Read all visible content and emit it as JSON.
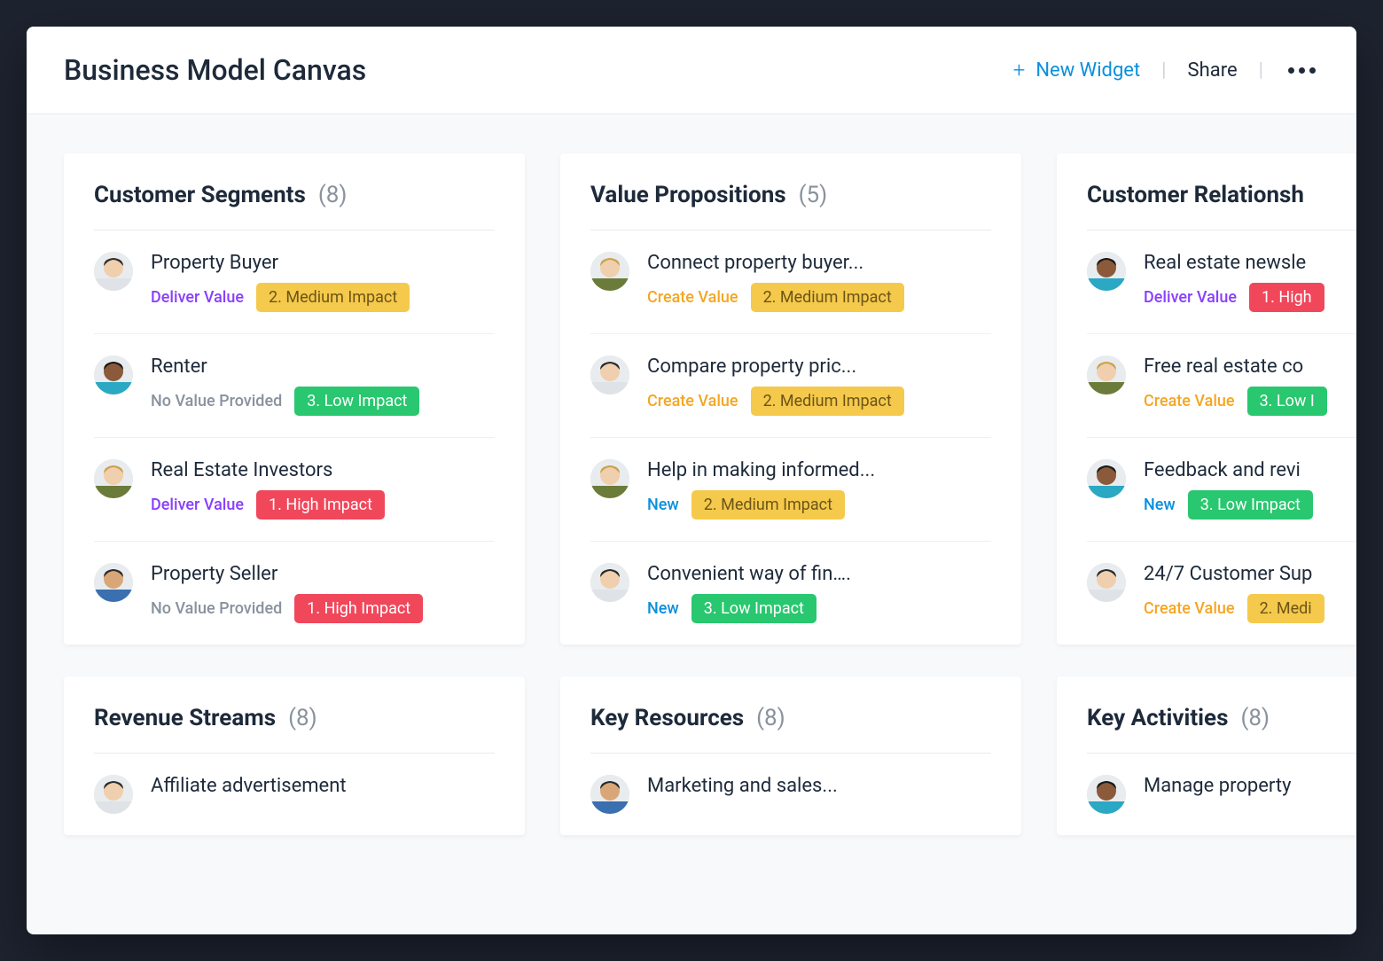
{
  "header": {
    "title": "Business Model Canvas",
    "newWidget": "New Widget",
    "share": "Share"
  },
  "tags": {
    "deliver": "Deliver Value",
    "create": "Create Value",
    "new": "New",
    "none": "No Value Provided"
  },
  "impact": {
    "high": "1. High Impact",
    "medium": "2. Medium Impact",
    "medi": "2. Medi",
    "low": "3. Low Impact",
    "lowI": "3. Low I"
  },
  "columns": [
    {
      "cards": [
        {
          "title": "Customer Segments",
          "count": "(8)",
          "rows": [
            {
              "title": "Property Buyer",
              "tag": "deliver",
              "impact": "medium",
              "avatar": "a1"
            },
            {
              "title": "Renter",
              "tag": "none",
              "impact": "low",
              "avatar": "a2",
              "ring": true
            },
            {
              "title": "Real Estate Investors",
              "tag": "deliver",
              "impact": "high",
              "avatar": "a3"
            },
            {
              "title": "Property Seller",
              "tag": "none",
              "impact": "high",
              "avatar": "a4"
            }
          ]
        },
        {
          "title": "Revenue Streams",
          "count": "(8)",
          "rows": [
            {
              "title": "Affiliate advertisement",
              "avatar": "a1"
            }
          ]
        }
      ]
    },
    {
      "cards": [
        {
          "title": "Value Propositions",
          "count": "(5)",
          "rows": [
            {
              "title": "Connect property buyer...",
              "tag": "create",
              "impact": "medium",
              "avatar": "a3"
            },
            {
              "title": "Compare property pric...",
              "tag": "create",
              "impact": "medium",
              "avatar": "a1"
            },
            {
              "title": "Help in making informed...",
              "tag": "new",
              "impact": "medium",
              "avatar": "a3"
            },
            {
              "title": "Convenient way of fin….",
              "tag": "new",
              "impact": "low",
              "avatar": "a1"
            }
          ]
        },
        {
          "title": "Key Resources",
          "count": "(8)",
          "rows": [
            {
              "title": "Marketing and sales...",
              "avatar": "a4"
            }
          ]
        }
      ]
    },
    {
      "cards": [
        {
          "title": "Customer Relationsh",
          "rows": [
            {
              "title": "Real estate newsle",
              "tag": "deliver",
              "impactLabel": "1. High",
              "impactClass": "high",
              "avatar": "a2",
              "ring": true
            },
            {
              "title": "Free real estate co",
              "tag": "create",
              "impactKey": "lowI",
              "impactClass": "low",
              "avatar": "a3"
            },
            {
              "title": "Feedback and revi",
              "tag": "new",
              "impact": "low",
              "avatar": "a2",
              "ring": true
            },
            {
              "title": "24/7 Customer Sup",
              "tag": "create",
              "impactKey": "medi",
              "impactClass": "medium",
              "avatar": "a1"
            }
          ]
        },
        {
          "title": "Key Activities",
          "count": "(8)",
          "rows": [
            {
              "title": "Manage property",
              "avatar": "a2",
              "ring": true
            }
          ]
        }
      ]
    }
  ]
}
